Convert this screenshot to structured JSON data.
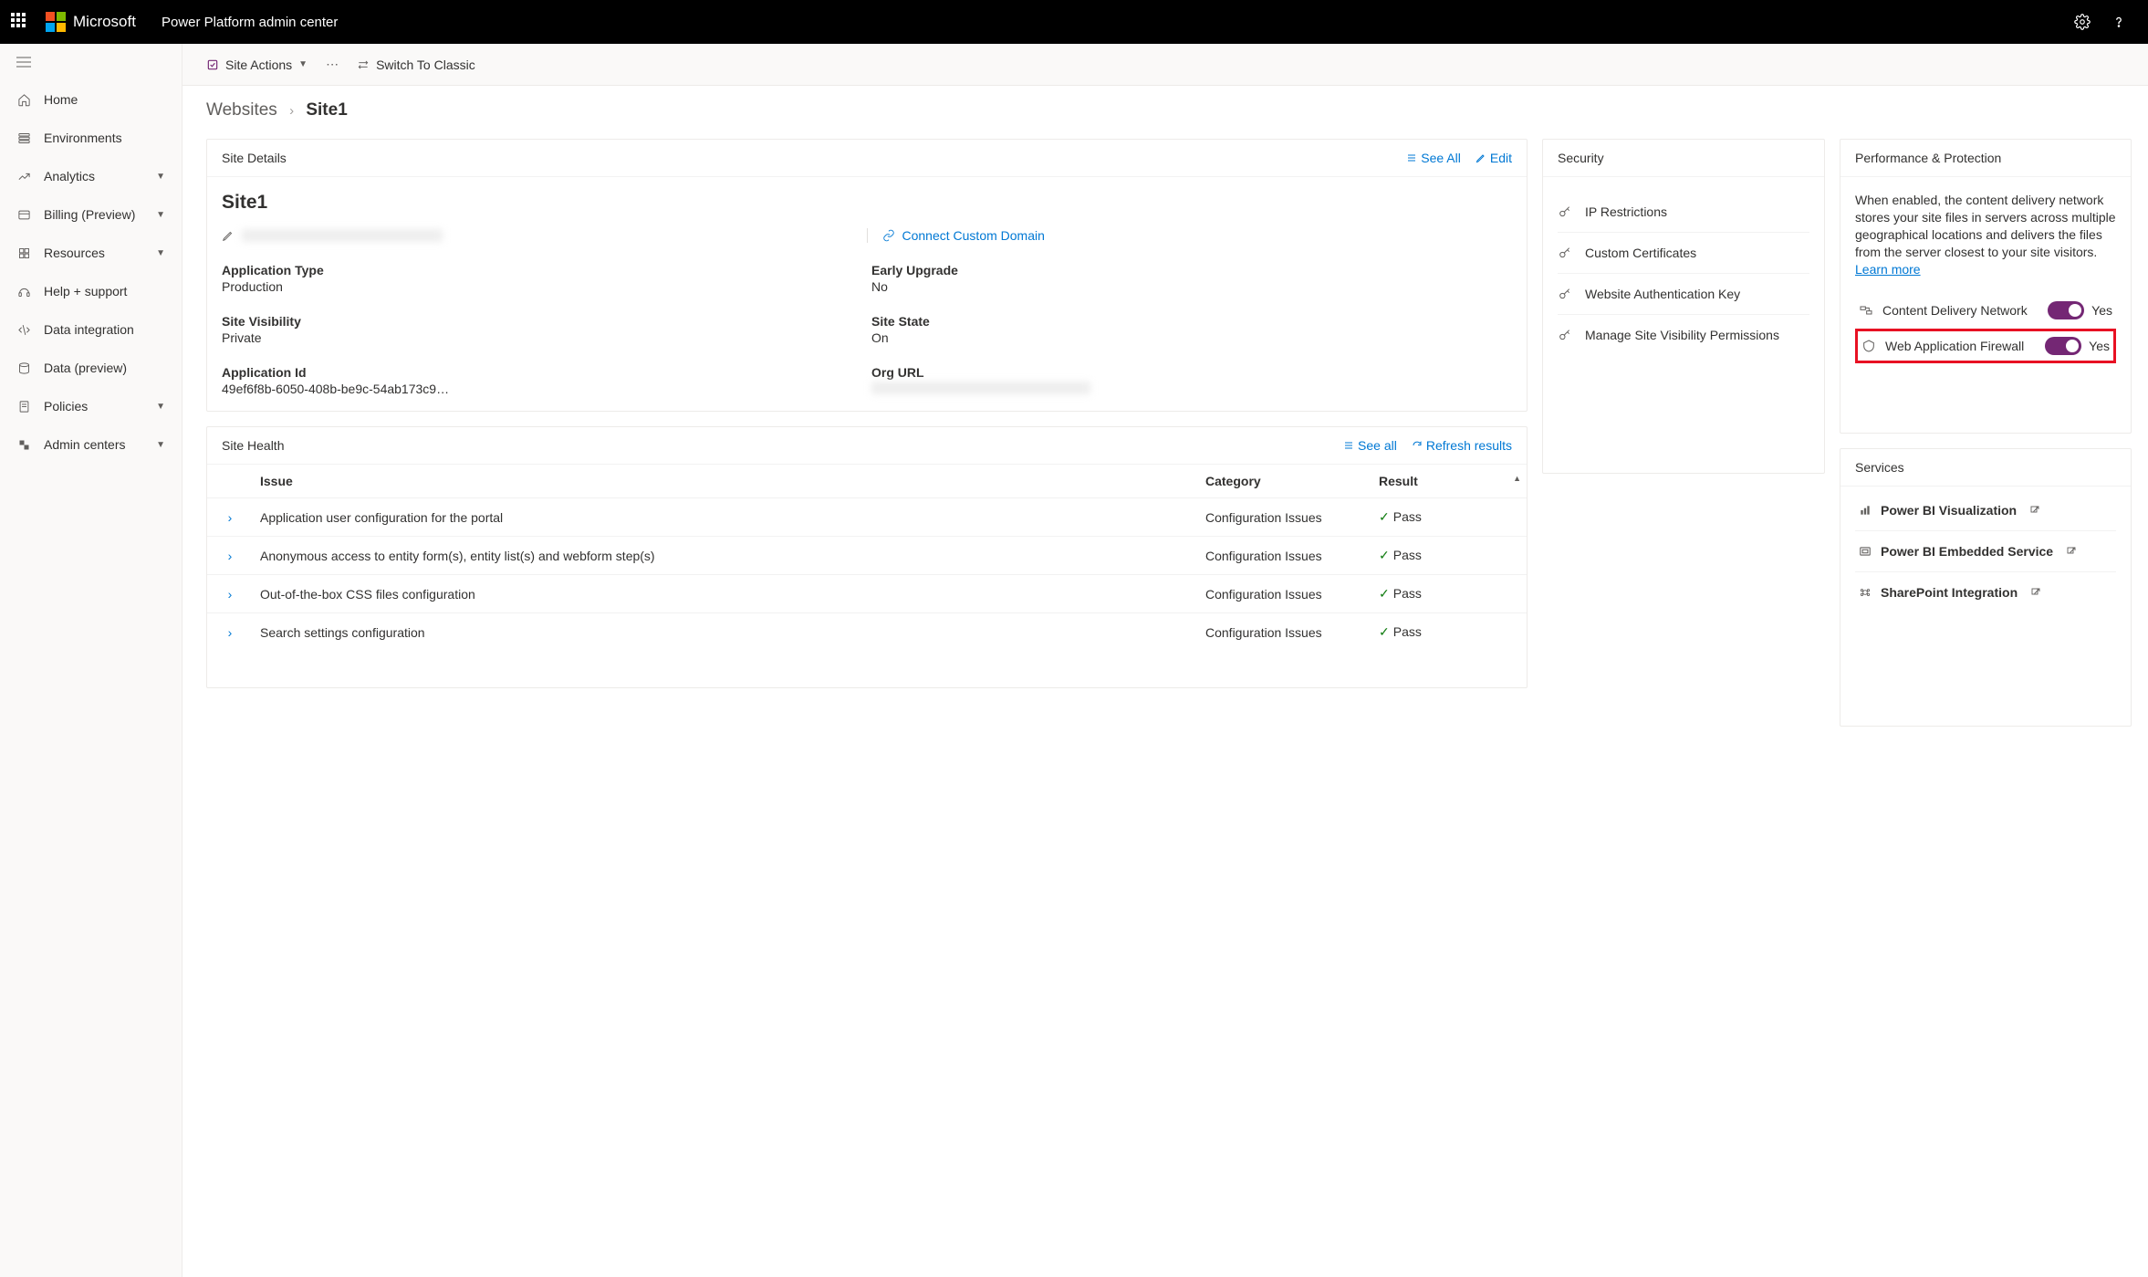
{
  "header": {
    "brand": "Microsoft",
    "app_title": "Power Platform admin center"
  },
  "sidebar": {
    "items": [
      {
        "label": "Home",
        "expandable": false
      },
      {
        "label": "Environments",
        "expandable": false
      },
      {
        "label": "Analytics",
        "expandable": true
      },
      {
        "label": "Billing (Preview)",
        "expandable": true
      },
      {
        "label": "Resources",
        "expandable": true
      },
      {
        "label": "Help + support",
        "expandable": false
      },
      {
        "label": "Data integration",
        "expandable": false
      },
      {
        "label": "Data (preview)",
        "expandable": false
      },
      {
        "label": "Policies",
        "expandable": true
      },
      {
        "label": "Admin centers",
        "expandable": true
      }
    ]
  },
  "toolbar": {
    "site_actions": "Site Actions",
    "switch_classic": "Switch To Classic"
  },
  "breadcrumb": {
    "root": "Websites",
    "current": "Site1"
  },
  "site_details": {
    "card_title": "Site Details",
    "see_all": "See All",
    "edit": "Edit",
    "site_name": "Site1",
    "connect_domain": "Connect Custom Domain",
    "fields": {
      "application_type_label": "Application Type",
      "application_type_value": "Production",
      "early_upgrade_label": "Early Upgrade",
      "early_upgrade_value": "No",
      "site_visibility_label": "Site Visibility",
      "site_visibility_value": "Private",
      "site_state_label": "Site State",
      "site_state_value": "On",
      "application_id_label": "Application Id",
      "application_id_value": "49ef6f8b-6050-408b-be9c-54ab173c9…",
      "org_url_label": "Org URL"
    }
  },
  "security": {
    "card_title": "Security",
    "items": [
      "IP Restrictions",
      "Custom Certificates",
      "Website Authentication Key",
      "Manage Site Visibility Permissions"
    ]
  },
  "performance": {
    "card_title": "Performance & Protection",
    "description": "When enabled, the content delivery network stores your site files in servers across multiple geographical locations and delivers the files from the server closest to your site visitors. ",
    "learn_more": "Learn more",
    "cdn_label": "Content Delivery Network",
    "cdn_state": "Yes",
    "waf_label": "Web Application Firewall",
    "waf_state": "Yes"
  },
  "site_health": {
    "card_title": "Site Health",
    "see_all": "See all",
    "refresh": "Refresh results",
    "columns": {
      "issue": "Issue",
      "category": "Category",
      "result": "Result"
    },
    "rows": [
      {
        "issue": "Application user configuration for the portal",
        "category": "Configuration Issues",
        "result": "Pass"
      },
      {
        "issue": "Anonymous access to entity form(s), entity list(s) and webform step(s)",
        "category": "Configuration Issues",
        "result": "Pass"
      },
      {
        "issue": "Out-of-the-box CSS files configuration",
        "category": "Configuration Issues",
        "result": "Pass"
      },
      {
        "issue": "Search settings configuration",
        "category": "Configuration Issues",
        "result": "Pass"
      }
    ]
  },
  "services": {
    "card_title": "Services",
    "items": [
      "Power BI Visualization",
      "Power BI Embedded Service",
      "SharePoint Integration"
    ]
  }
}
